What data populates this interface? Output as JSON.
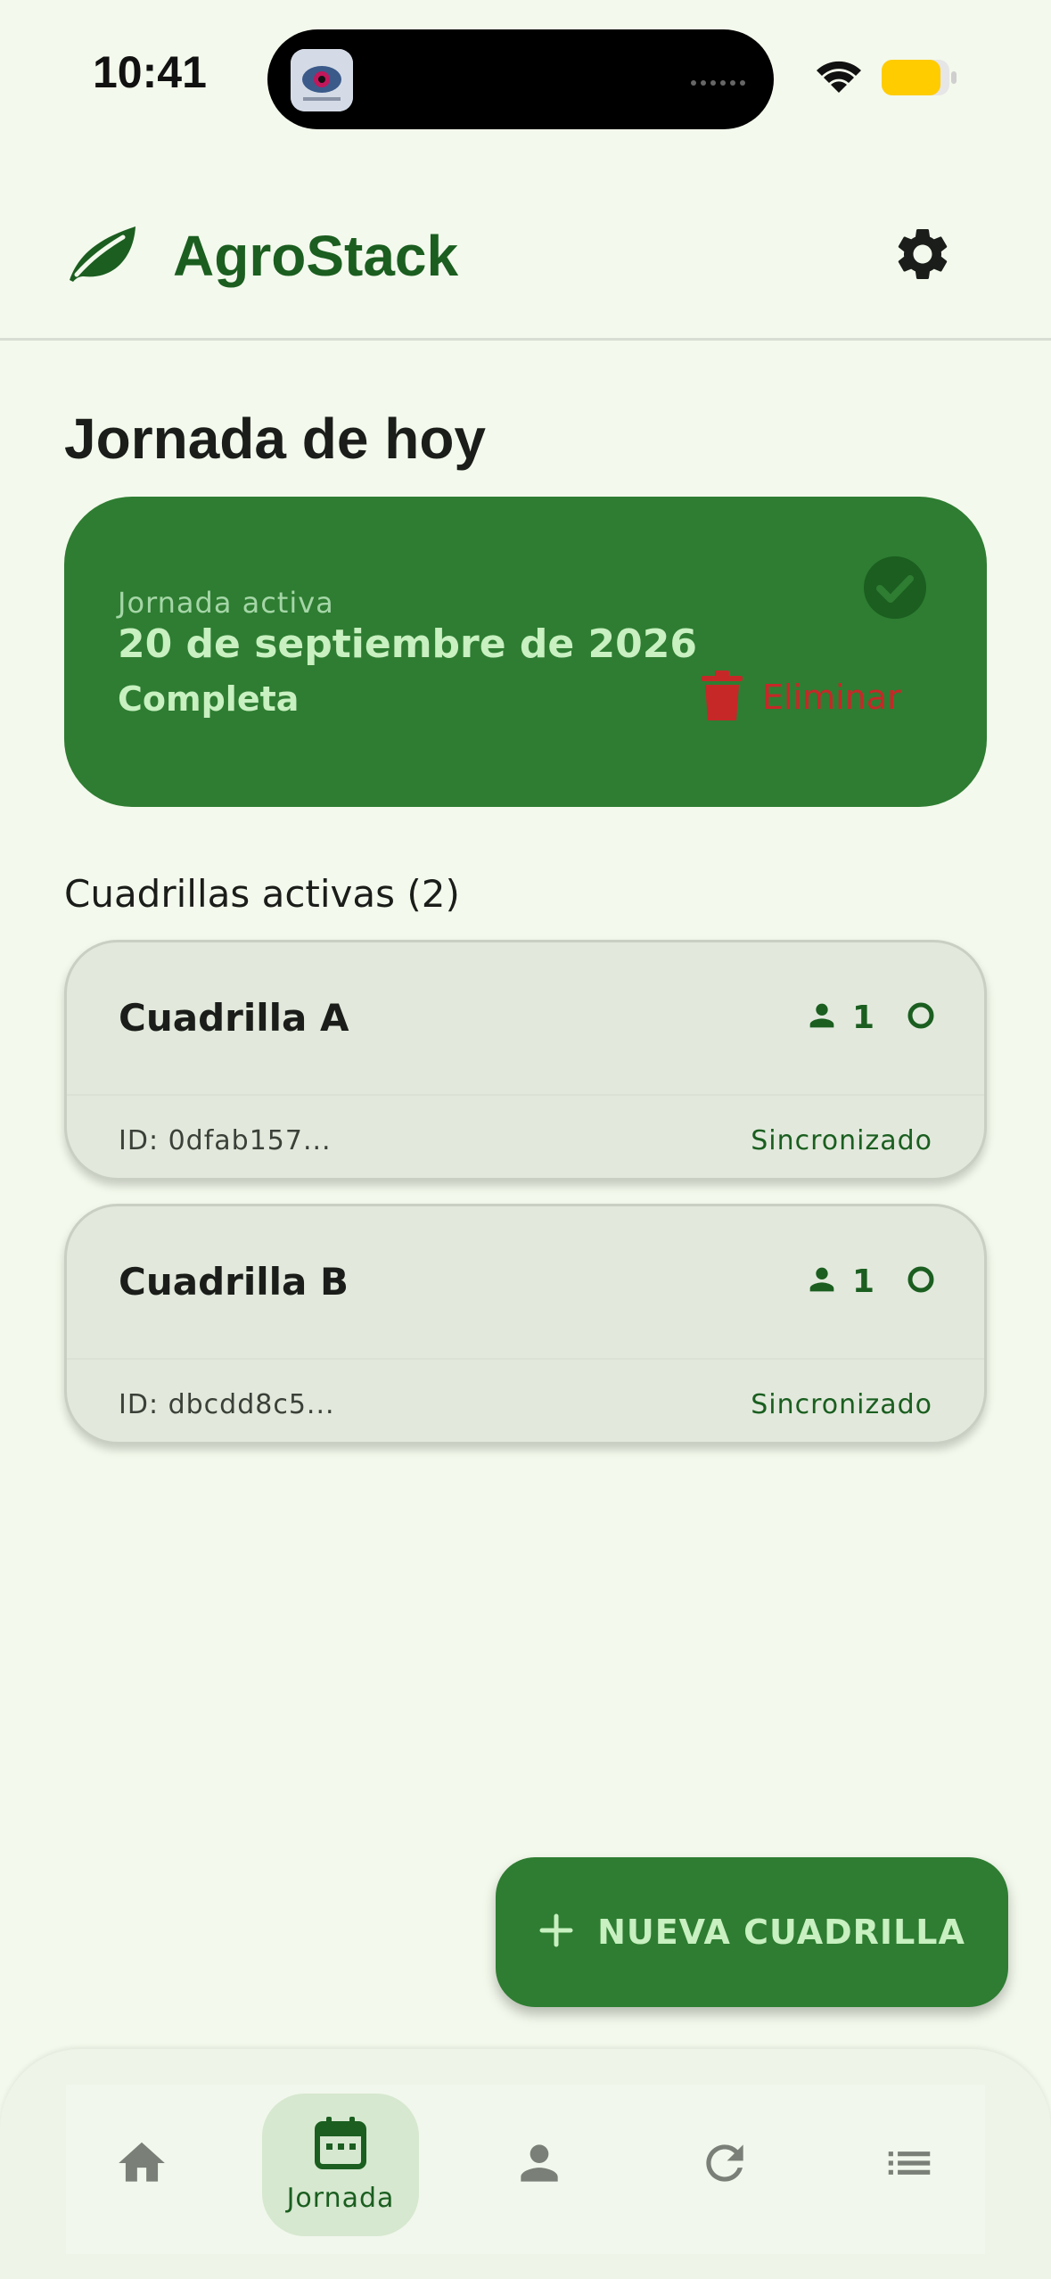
{
  "status_bar": {
    "time": "10:41"
  },
  "header": {
    "app_name": "AgroStack",
    "logo_icon": "leaf-icon",
    "settings_icon": "gear-icon"
  },
  "page_title": "Jornada de hoy",
  "active_day": {
    "label": "Jornada activa",
    "date": "20 de septiembre de 2026",
    "status": "Completa",
    "status_icon": "check-circle-icon",
    "delete_label": "Eliminar",
    "delete_icon": "trash-icon"
  },
  "crews_section": {
    "title": "Cuadrillas activas (2)",
    "crews": [
      {
        "name": "Cuadrilla A",
        "members": "1",
        "id": "ID: 0dfab157...",
        "sync": "Sincronizado"
      },
      {
        "name": "Cuadrilla B",
        "members": "1",
        "id": "ID: dbcdd8c5...",
        "sync": "Sincronizado"
      }
    ]
  },
  "fab": {
    "label": "NUEVA CUADRILLA",
    "icon": "plus-icon"
  },
  "bottom_nav": {
    "items": [
      {
        "icon": "home-icon",
        "label": ""
      },
      {
        "icon": "calendar-icon",
        "label": "Jornada"
      },
      {
        "icon": "person-icon",
        "label": ""
      },
      {
        "icon": "refresh-icon",
        "label": ""
      },
      {
        "icon": "list-icon",
        "label": ""
      }
    ],
    "active_index": 1
  },
  "colors": {
    "background": "#f3f9ec",
    "primary": "#2e7d32",
    "primary_dark": "#1b5e20",
    "danger": "#c62828",
    "on_primary": "#c8f0c0"
  }
}
